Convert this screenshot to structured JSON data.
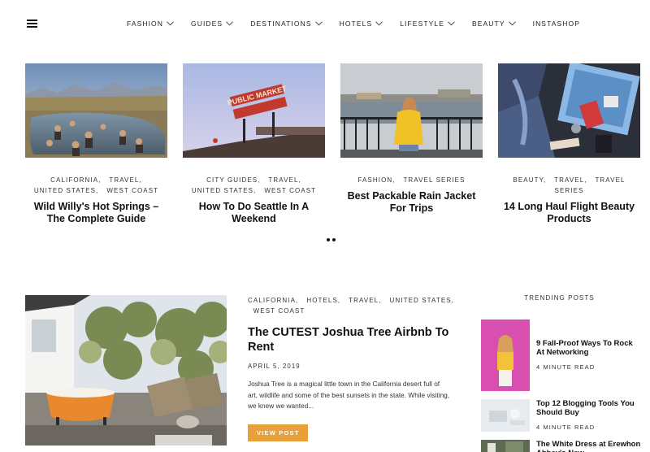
{
  "nav": {
    "items": [
      {
        "label": "FASHION",
        "dropdown": true
      },
      {
        "label": "GUIDES",
        "dropdown": true
      },
      {
        "label": "DESTINATIONS",
        "dropdown": true
      },
      {
        "label": "HOTELS",
        "dropdown": true
      },
      {
        "label": "LIFESTYLE",
        "dropdown": true
      },
      {
        "label": "BEAUTY",
        "dropdown": true
      },
      {
        "label": "INSTASHOP",
        "dropdown": false
      }
    ]
  },
  "carousel": {
    "cards": [
      {
        "cats": [
          "CALIFORNIA",
          "TRAVEL",
          "UNITED STATES",
          "WEST COAST"
        ],
        "title": "Wild Willy's Hot Springs – The Complete Guide"
      },
      {
        "cats": [
          "CITY GUIDES",
          "TRAVEL",
          "UNITED STATES",
          "WEST COAST"
        ],
        "title": "How To Do Seattle In A Weekend",
        "sign_text": "PUBLIC MARKET"
      },
      {
        "cats": [
          "FASHION",
          "TRAVEL SERIES"
        ],
        "title": "Best Packable Rain Jacket For Trips"
      },
      {
        "cats": [
          "BEAUTY",
          "TRAVEL",
          "TRAVEL SERIES"
        ],
        "title": "14 Long Haul Flight Beauty Products"
      }
    ]
  },
  "featured": {
    "cats": [
      "CALIFORNIA",
      "HOTELS",
      "TRAVEL",
      "UNITED STATES",
      "WEST COAST"
    ],
    "title": "The CUTEST Joshua Tree Airbnb To Rent",
    "date": "APRIL 5, 2019",
    "excerpt": "Joshua Tree is a magical little town in the California desert full of art, wildlife and some of the best sunsets in the state. While visiting, we knew we wanted...",
    "button": "VIEW POST"
  },
  "trending": {
    "heading": "TRENDING POSTS",
    "items": [
      {
        "title": "9 Fall-Proof Ways To Rock At Networking",
        "read": "4 MINUTE READ"
      },
      {
        "title": "Top 12 Blogging Tools You Should Buy",
        "read": "4 MINUTE READ"
      },
      {
        "title": "The White Dress at Erewhon Abbey's New",
        "read": ""
      }
    ]
  },
  "colors": {
    "accent": "#e8a13a",
    "text": "#111111",
    "muted": "#333333"
  }
}
